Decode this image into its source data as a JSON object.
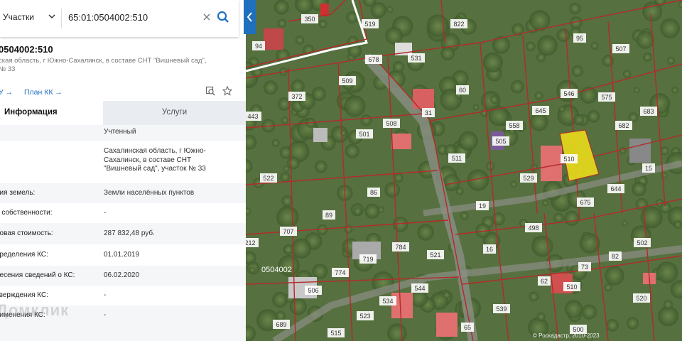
{
  "search": {
    "type_label": "Участки",
    "query": "65:01:0504002:510"
  },
  "parcel": {
    "cad_number": "0504002:510",
    "address_line1": "ская область, г Южно-Сахалинск, в составе СНТ \"Вишневый сад\",",
    "address_line2": "№ 33",
    "link_left": "У →",
    "link_plan": "План КК →"
  },
  "tabs": {
    "info": "Информация",
    "services": "Услуги"
  },
  "fields": [
    {
      "label": "",
      "value": "Учтенный"
    },
    {
      "label": "",
      "value_lines": [
        "Сахалинская область, г Южно-",
        "Сахалинск, в составе СНТ",
        "\"Вишневый сад\", участок № 33"
      ]
    },
    {
      "label": "рия земель:",
      "value": "Земли населённых пунктов"
    },
    {
      "label": "о собственности:",
      "value": "-"
    },
    {
      "label": "ровая стоимость:",
      "value": "287 832,48 руб."
    },
    {
      "label": "пределения КС:",
      "value": "01.01.2019"
    },
    {
      "label": "несения сведений о КС:",
      "value": "06.02.2020"
    },
    {
      "label": "тверждения КС:",
      "value": "-"
    },
    {
      "label": "рименения КС:",
      "value": "-"
    }
  ],
  "watermark": "Домклик",
  "map": {
    "block_label": "0504002",
    "parcels": [
      {
        "n": "350"
      },
      {
        "n": "519"
      },
      {
        "n": "822"
      },
      {
        "n": "95"
      },
      {
        "n": "507"
      },
      {
        "n": "94"
      },
      {
        "n": "678"
      },
      {
        "n": "531"
      },
      {
        "n": "509"
      },
      {
        "n": "372"
      },
      {
        "n": "60"
      },
      {
        "n": "546"
      },
      {
        "n": "575"
      },
      {
        "n": "645"
      },
      {
        "n": "683"
      },
      {
        "n": "443"
      },
      {
        "n": "31"
      },
      {
        "n": "508"
      },
      {
        "n": "558"
      },
      {
        "n": "682"
      },
      {
        "n": "501"
      },
      {
        "n": "505"
      },
      {
        "n": "511"
      },
      {
        "n": "510"
      },
      {
        "n": "15"
      },
      {
        "n": "522"
      },
      {
        "n": "86"
      },
      {
        "n": "529"
      },
      {
        "n": "644"
      },
      {
        "n": "89"
      },
      {
        "n": "19"
      },
      {
        "n": "675"
      },
      {
        "n": "707"
      },
      {
        "n": "498"
      },
      {
        "n": "502"
      },
      {
        "n": "212"
      },
      {
        "n": "784"
      },
      {
        "n": "521"
      },
      {
        "n": "16"
      },
      {
        "n": "719"
      },
      {
        "n": "73"
      },
      {
        "n": "82"
      },
      {
        "n": "774"
      },
      {
        "n": "506"
      },
      {
        "n": "544"
      },
      {
        "n": "62"
      },
      {
        "n": "510"
      },
      {
        "n": "534"
      },
      {
        "n": "539"
      },
      {
        "n": "520"
      },
      {
        "n": "523"
      },
      {
        "n": "689"
      },
      {
        "n": "515"
      },
      {
        "n": "500"
      },
      {
        "n": "65"
      }
    ],
    "copyright": "© Роскадастр, 2010-2023"
  }
}
